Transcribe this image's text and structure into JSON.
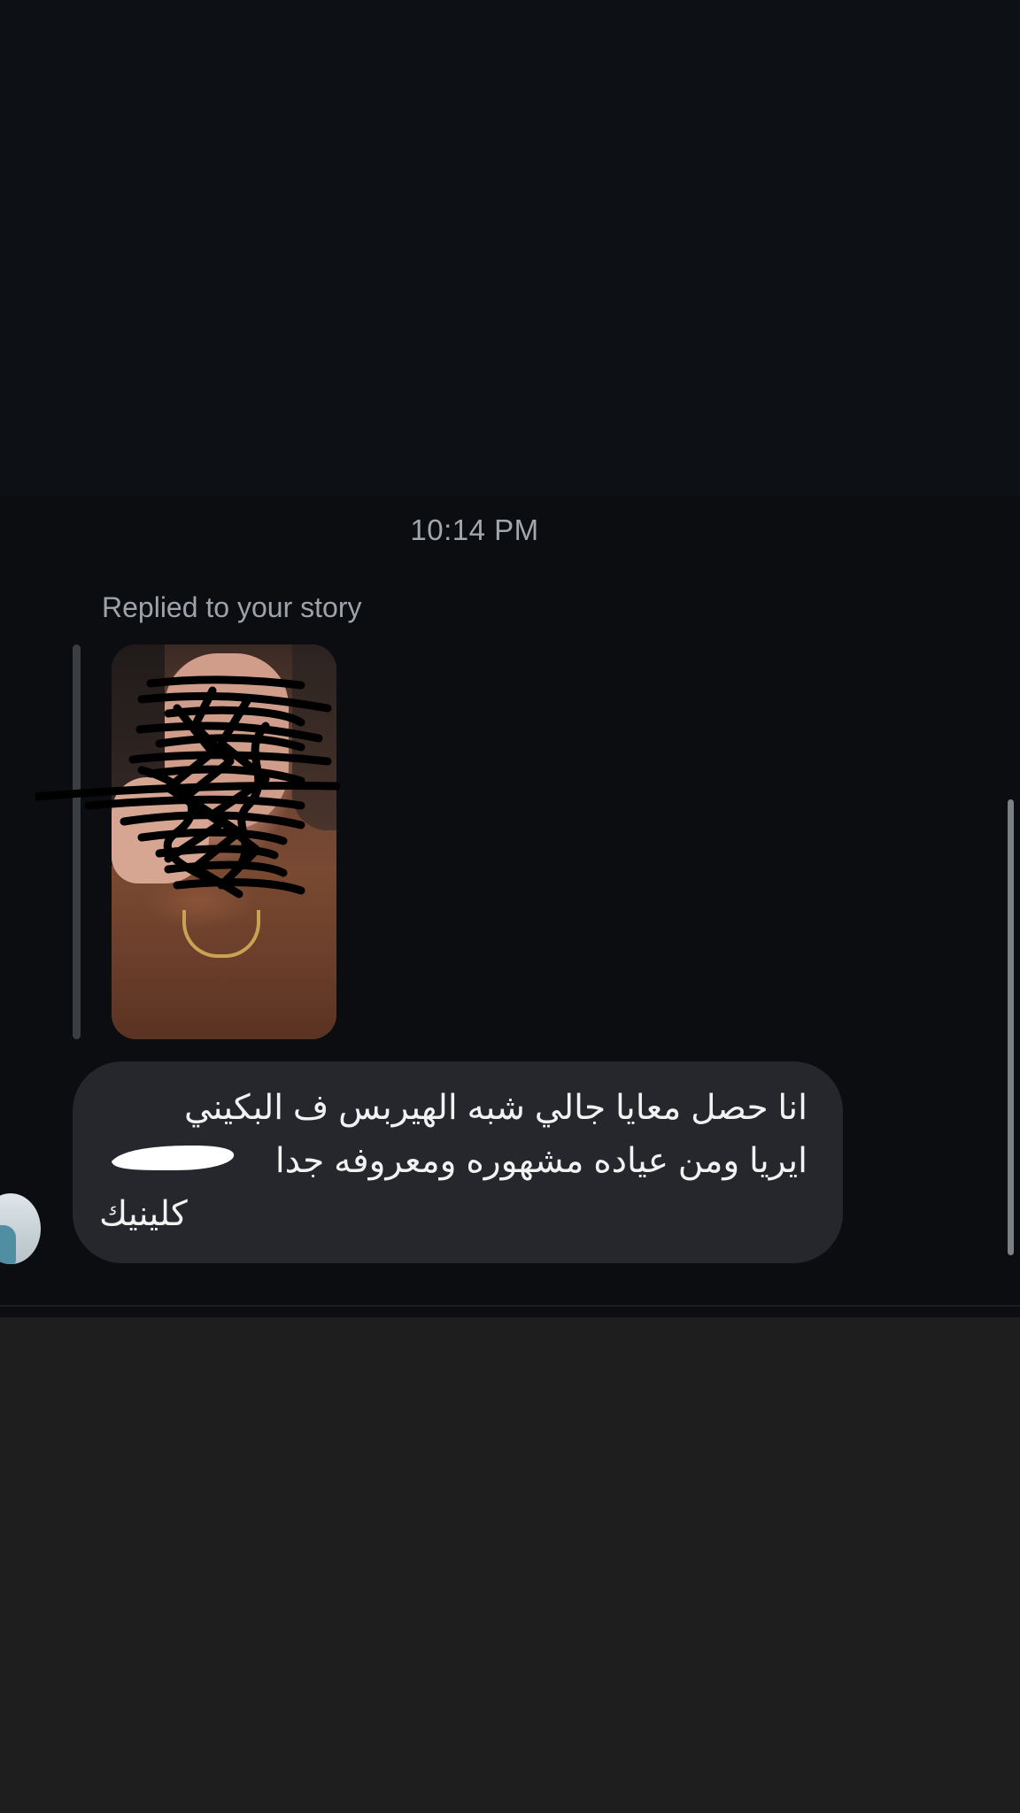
{
  "thread": {
    "timestamp": "10:14 PM",
    "reply_label": "Replied to your story"
  },
  "message": {
    "lines": [
      "انا حصل معايا جالي شبه الهيربس ف البكيني",
      "ايريا ومن عياده مشهوره ومعروفه جدا",
      "كلينيك"
    ]
  },
  "story_preview": {
    "type": "story-thumbnail",
    "redacted": true
  },
  "colors": {
    "background_top": "#0d1014",
    "background_chat": "#0b0d11",
    "background_bottom": "#1e1e1e",
    "bubble": "#25272c",
    "text_primary": "#f2f2f2",
    "text_secondary": "#a2a6ad"
  }
}
